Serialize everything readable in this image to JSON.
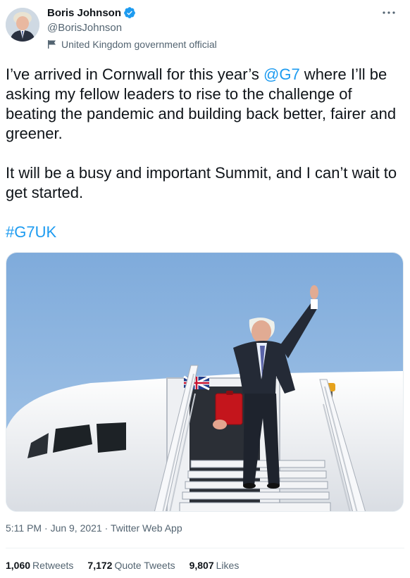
{
  "author": {
    "name": "Boris Johnson",
    "handle": "@BorisJohnson",
    "label": "United Kingdom government official"
  },
  "icons": {
    "verified": "verified-badge-icon",
    "label": "flag-icon",
    "more": "more-icon"
  },
  "tweet": {
    "p1_a": "I’ve arrived in Cornwall for this year’s ",
    "mention": "@G7",
    "p1_b": " where I’ll be asking my fellow leaders to rise to the challenge of beating the pandemic and building back better, fairer and greener.",
    "p2": "It will be a busy and important Summit, and I can’t wait to get started.",
    "hashtag": "#G7UK"
  },
  "meta": {
    "time": "5:11 PM",
    "dot1": " · ",
    "date": "Jun 9, 2021",
    "dot2": " · ",
    "source": "Twitter Web App"
  },
  "stats": {
    "retweets_count": "1,060",
    "retweets_label": "Retweets",
    "quotes_count": "7,172",
    "quotes_label": "Quote Tweets",
    "likes_count": "9,807",
    "likes_label": "Likes"
  },
  "colors": {
    "link": "#1d9bf0",
    "sky": "#8fb6e0",
    "aircraft": "#f4f5f7",
    "briefcase": "#c4151c"
  }
}
